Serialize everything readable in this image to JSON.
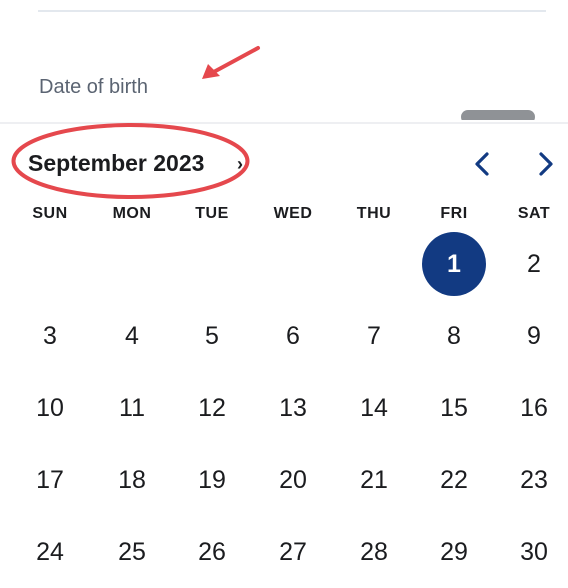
{
  "form": {
    "dob_label": "Date of birth"
  },
  "calendar": {
    "month_title": "September 2023",
    "month_chevron": "›",
    "prev_icon": "chevron-left-icon",
    "next_icon": "chevron-right-icon",
    "weekdays": [
      "SUN",
      "MON",
      "TUE",
      "WED",
      "THU",
      "FRI",
      "SAT"
    ],
    "selected_day": "1",
    "weeks": [
      [
        "",
        "",
        "",
        "",
        "",
        "1",
        "2"
      ],
      [
        "3",
        "4",
        "5",
        "6",
        "7",
        "8",
        "9"
      ],
      [
        "10",
        "11",
        "12",
        "13",
        "14",
        "15",
        "16"
      ],
      [
        "17",
        "18",
        "19",
        "20",
        "21",
        "22",
        "23"
      ],
      [
        "24",
        "25",
        "26",
        "27",
        "28",
        "29",
        "30"
      ]
    ]
  },
  "annotations": {
    "arrow_color": "#e5484d",
    "ellipse_color": "#e5484d"
  },
  "colors": {
    "accent": "#123a82",
    "label": "#5b6472",
    "text": "#1b1c1f"
  }
}
